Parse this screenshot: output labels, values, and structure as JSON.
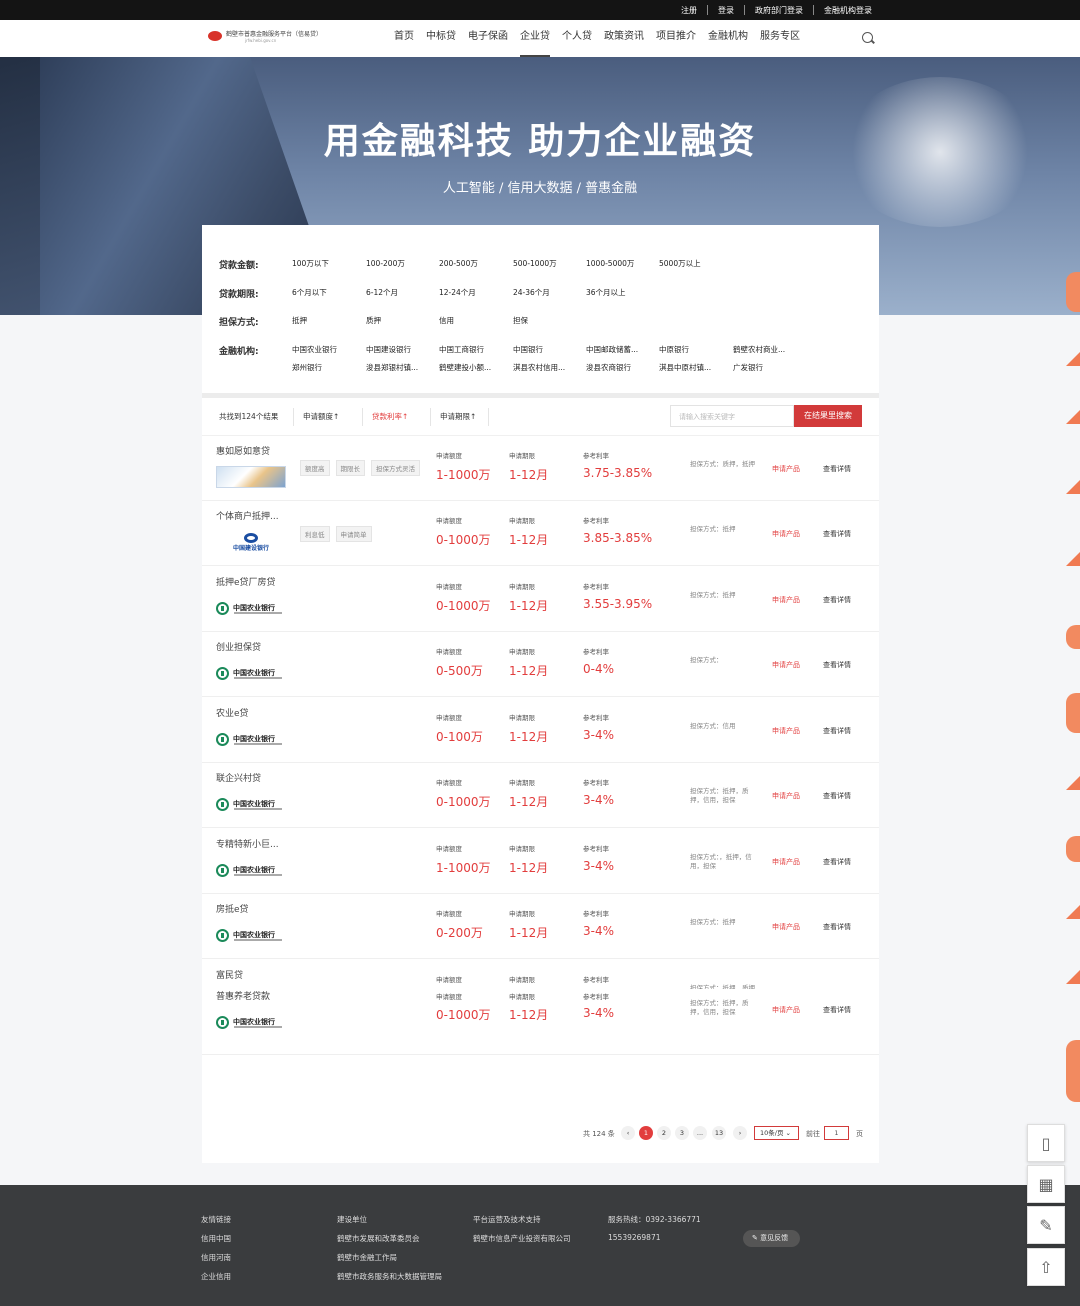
{
  "topbar": {
    "register": "注册",
    "login": "登录",
    "gov_login": "政府部门登录",
    "fin_login": "金融机构登录"
  },
  "logo": {
    "title": "鹤壁市普惠金融服务平台（信易贷）",
    "subtitle": "jrfw.hebi.gov.cn"
  },
  "nav": [
    "首页",
    "中标贷",
    "电子保函",
    "企业贷",
    "个人贷",
    "政策资讯",
    "项目推介",
    "金融机构",
    "服务专区"
  ],
  "nav_active": "企业贷",
  "banner": {
    "title": "用金融科技 助力企业融资",
    "subtitle": "人工智能 / 信用大数据 / 普惠金融"
  },
  "filters": {
    "amount_label": "贷款金额:",
    "amount": [
      "100万以下",
      "100-200万",
      "200-500万",
      "500-1000万",
      "1000-5000万",
      "5000万以上"
    ],
    "term_label": "贷款期限:",
    "term": [
      "6个月以下",
      "6-12个月",
      "12-24个月",
      "24-36个月",
      "36个月以上"
    ],
    "guarantee_label": "担保方式:",
    "guarantee": [
      "抵押",
      "质押",
      "信用",
      "担保"
    ],
    "institution_label": "金融机构:",
    "institutions": [
      "中国农业银行",
      "中国建设银行",
      "中国工商银行",
      "中国银行",
      "中国邮政储蓄...",
      "中原银行",
      "鹤壁农村商业...",
      "郑州银行",
      "浚县郑银村镇...",
      "鹤壁建投小额...",
      "淇县农村信用...",
      "浚县农商银行",
      "淇县中原村镇...",
      "广发银行"
    ]
  },
  "sortbar": {
    "count": "共找到124个结果",
    "sort1": "申请额度↑",
    "sort2": "贷款利率↑",
    "sort3": "申请期限↑",
    "search_placeholder": "请输入搜索关键字",
    "search_button": "在结果里搜索"
  },
  "col_heads": {
    "amount": "申请额度",
    "term": "申请期限",
    "rate": "参考利率"
  },
  "actions": {
    "apply": "申请产品",
    "detail": "查看详情"
  },
  "products": [
    {
      "name": "惠如愿如意贷",
      "logo": "hui",
      "tags": [
        "额度高",
        "期限长",
        "担保方式灵活"
      ],
      "amount": "1-1000万",
      "term": "1-12月",
      "rate": "3.75-3.85%",
      "guarantee": "担保方式：质押，抵押"
    },
    {
      "name": "个体商户抵押...",
      "logo": "ccb",
      "tags": [
        "利息低",
        "申请简单"
      ],
      "amount": "0-1000万",
      "term": "1-12月",
      "rate": "3.85-3.85%",
      "guarantee": "担保方式：抵押"
    },
    {
      "name": "抵押e贷厂房贷",
      "logo": "abc",
      "tags": [],
      "amount": "0-1000万",
      "term": "1-12月",
      "rate": "3.55-3.95%",
      "guarantee": "担保方式：抵押"
    },
    {
      "name": "创业担保贷",
      "logo": "abc",
      "tags": [],
      "amount": "0-500万",
      "term": "1-12月",
      "rate": "0-4%",
      "guarantee": "担保方式："
    },
    {
      "name": "农业e贷",
      "logo": "abc",
      "tags": [],
      "amount": "0-100万",
      "term": "1-12月",
      "rate": "3-4%",
      "guarantee": "担保方式：信用"
    },
    {
      "name": "联企兴村贷",
      "logo": "abc",
      "tags": [],
      "amount": "0-1000万",
      "term": "1-12月",
      "rate": "3-4%",
      "guarantee": "担保方式：抵押，质押，信用，担保"
    },
    {
      "name": "专精特新小巨...",
      "logo": "abc",
      "tags": [],
      "amount": "1-1000万",
      "term": "1-12月",
      "rate": "3-4%",
      "guarantee": "担保方式：，抵押，信用，担保"
    },
    {
      "name": "房抵e贷",
      "logo": "abc",
      "tags": [],
      "amount": "0-200万",
      "term": "1-12月",
      "rate": "3-4%",
      "guarantee": "担保方式：抵押"
    },
    {
      "name": "富民贷",
      "logo": "none",
      "tags": [],
      "amount": "0-100万",
      "term": "1-12月",
      "rate": "3-4%",
      "guarantee": "担保方式：抵押，质押"
    },
    {
      "name": "普惠养老贷款",
      "logo": "abc",
      "tags": [],
      "amount": "0-1000万",
      "term": "1-12月",
      "rate": "3-4%",
      "guarantee": "担保方式：抵押，质押，信用，担保"
    }
  ],
  "bank_names": {
    "abc": "中国农业银行",
    "ccb": "中国建设银行"
  },
  "pager": {
    "total": "共 124 条",
    "pages": [
      "1",
      "2",
      "3",
      "...",
      "13"
    ],
    "prev": "‹",
    "next": "›",
    "page_size": "10条/页",
    "goto": "前往",
    "goto_value": "1",
    "page_word": "页"
  },
  "footer": {
    "col1": [
      "友情链接",
      "信用中国",
      "信用河南",
      "企业信用"
    ],
    "col2": [
      "建设单位",
      "鹤壁市发展和改革委员会",
      "鹤壁市金融工作局",
      "鹤壁市政务服务和大数据管理局"
    ],
    "col3": [
      "平台运营及技术支持",
      "鹤壁市信息产业投资有限公司"
    ],
    "col4": [
      "服务热线：0392-3366771",
      "15539269871"
    ],
    "feedback": "意见反馈"
  },
  "colors": {
    "accent": "#e23d3d",
    "topbar": "#141414",
    "footer": "#3a3c3e"
  }
}
